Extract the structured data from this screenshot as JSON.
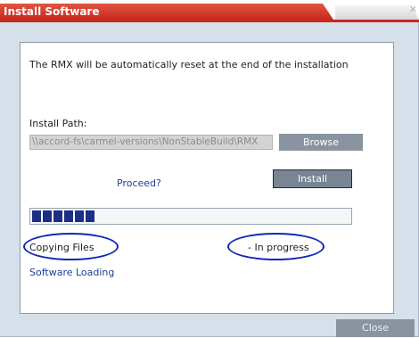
{
  "window": {
    "title": "Install Software",
    "close_glyph": "✕"
  },
  "panel": {
    "reset_notice": "The RMX will be automatically reset at the end of the installation",
    "install_path_label": "Install Path:",
    "install_path_value": "\\\\accord-fs\\carmel-versions\\NonStableBuild\\RMX",
    "browse_label": "Browse",
    "proceed_label": "Proceed?",
    "install_label": "Install",
    "progress_fraction": 0.19,
    "status_left": "Copying Files",
    "status_right": "- In progress",
    "stage_label": "Software Loading"
  },
  "footer": {
    "close_label": "Close"
  },
  "colors": {
    "title_red": "#c8281e",
    "progress_blue": "#1c2f86",
    "annotation_blue": "#1226b8"
  }
}
